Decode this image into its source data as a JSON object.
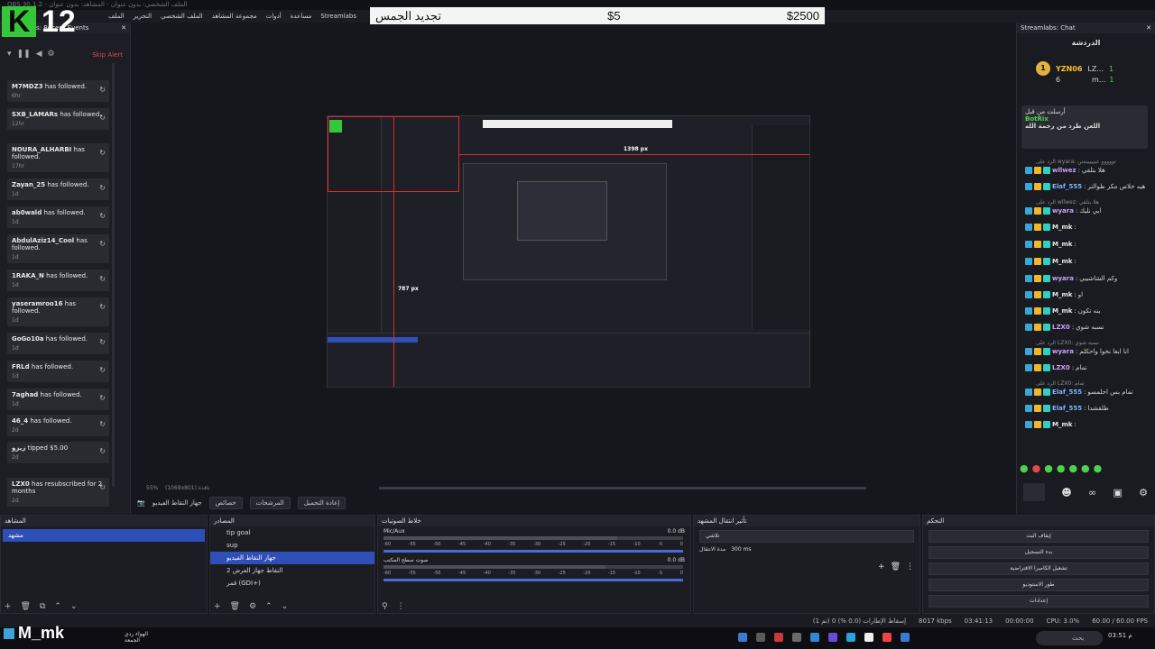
{
  "window": {
    "title": "OBS 30.1.2 - الملف الشخصي: بدون عنوان - المشاهد: بدون عنوان"
  },
  "menu": [
    "الملف",
    "التحرير",
    "الملف الشخصي",
    "مجموعة المشاهد",
    "أدوات",
    "مساعدة",
    "Streamlabs"
  ],
  "logo": {
    "letter": "K",
    "number": "12"
  },
  "goal": {
    "title": "تجديد الجمس",
    "amount": "$5",
    "target": "$2500"
  },
  "events_panel": {
    "title": "Streamlabs: Recent Events",
    "skip_label": "Skip Alert",
    "items": [
      {
        "name": "M7MDZ3",
        "text": " has followed.",
        "time": "6hr"
      },
      {
        "name": "SXB_LAMARs",
        "text": " has followed.",
        "time": "12hr"
      },
      {
        "name": "NOURA_ALHARBI",
        "text": " has followed.",
        "time": "17hr"
      },
      {
        "name": "Zayan_25",
        "text": " has followed.",
        "time": "1d"
      },
      {
        "name": "ab0wald",
        "text": " has followed.",
        "time": "1d"
      },
      {
        "name": "AbdulAziz14_Cool",
        "text": " has followed.",
        "time": "1d"
      },
      {
        "name": "1RAKA_N",
        "text": " has followed.",
        "time": "1d"
      },
      {
        "name": "yaseramroo16",
        "text": " has followed.",
        "time": "1d"
      },
      {
        "name": "GoGo10a",
        "text": " has followed.",
        "time": "1d"
      },
      {
        "name": "FRLd",
        "text": " has followed.",
        "time": "1d"
      },
      {
        "name": "7aghad",
        "text": " has followed.",
        "time": "1d"
      },
      {
        "name": "46_4",
        "text": " has followed.",
        "time": "2d"
      },
      {
        "name": "زيزو",
        "text": " tipped $5.00",
        "time": "2d"
      },
      {
        "name": "LZX0",
        "text": " has resubscribed for 2 months",
        "time": "2d"
      }
    ]
  },
  "preview": {
    "width_label": "1398 px",
    "height_label": "787 px",
    "zoom": "55%",
    "status": "(1069x801) نافذة"
  },
  "scene_tools": [
    "إعادة التحميل",
    "المرشحات",
    "خصائص",
    "جهاز التقاط الفيديو"
  ],
  "chat": {
    "title": "Streamlabs: Chat",
    "heading": "الدردشة",
    "top": [
      {
        "name": "YZN06",
        "count": "6"
      },
      {
        "name": "LZ...",
        "count": "1"
      },
      {
        "name": "m...",
        "count": "1"
      }
    ],
    "pinned": {
      "label": "أرسلت من قبل",
      "user": "BotRix",
      "text": "اللعن طرد من رحمة الله"
    },
    "messages": [
      {
        "reply": "الرد على wyara: تووووو عيييييينننن",
        "user": "wllwez",
        "text": "هلا بتلقي",
        "color": "#c9a0ff"
      },
      {
        "user": "Elaf_555",
        "text": "هيه خلاص مكر طوالتر",
        "color": "#79b6ff"
      },
      {
        "reply": "الرد على wllwez: هلا بتلقي",
        "user": "wyara",
        "text": "ابي نليك",
        "color": "#c9a0ff"
      },
      {
        "user": "M_mk",
        "text": "",
        "color": "#e6e6e6"
      },
      {
        "user": "M_mk",
        "text": "",
        "color": "#e6e6e6"
      },
      {
        "user": "M_mk",
        "text": "",
        "color": "#e6e6e6"
      },
      {
        "user": "wyara",
        "text": "وكم الشاشيبي",
        "color": "#c9a0ff"
      },
      {
        "user": "M_mk",
        "text": "او",
        "color": "#e6e6e6"
      },
      {
        "user": "M_mk",
        "text": "ينه تكون",
        "color": "#e6e6e6"
      },
      {
        "user": "LZX0",
        "text": "نسبه شوي",
        "color": "#c9a0ff"
      },
      {
        "reply": "الرد على LZX0: نسبه شوي",
        "user": "wyara",
        "text": "انا ابغا نخوا واحكلم",
        "color": "#c9a0ff"
      },
      {
        "user": "LZX0",
        "text": "تمام",
        "color": "#c9a0ff"
      },
      {
        "reply": "الرد على LZX0: تمام",
        "user": "Elaf_555",
        "text": "تمام بس احلمسو",
        "color": "#79b6ff"
      },
      {
        "user": "Elaf_555",
        "text": "طلقشدا",
        "color": "#79b6ff"
      },
      {
        "user": "M_mk",
        "text": "",
        "color": "#e6e6e6"
      }
    ]
  },
  "docks": {
    "scenes": {
      "title": "المشاهد",
      "items": [
        "مشهد"
      ]
    },
    "sources": {
      "title": "المصادر",
      "items": [
        "tip goal",
        "sup",
        "جهاز التقاط الفيديو",
        "التقاط جهاز العرض 2",
        "قمر (GDI+)"
      ]
    },
    "mixer": {
      "title": "خلاط الصوتيات",
      "channels": [
        {
          "name": "Mic/Aux",
          "db": "0.0 dB",
          "level": 0.78
        },
        {
          "name": "صوت سطح المكتب",
          "db": "0.0 dB",
          "level": 0.74
        }
      ],
      "scale": [
        "-60",
        "-55",
        "-50",
        "-45",
        "-40",
        "-35",
        "-30",
        "-25",
        "-20",
        "-15",
        "-10",
        "-5",
        "0"
      ]
    },
    "transitions": {
      "title": "تأثير انتقال المشهد",
      "selected": "تلاشي",
      "duration_label": "مدة الانتقال",
      "duration": "300 ms"
    },
    "controls": {
      "title": "التحكم",
      "buttons": [
        "إيقاف البث",
        "بدء التسجيل",
        "تشغيل الكاميرا الافتراضية",
        "طور الاستوديو",
        "إعدادات"
      ]
    }
  },
  "statusbar": {
    "dropped": "إسقاط الإطارات (0.0 %) 0 (تم 1)",
    "bitrate": "8017 kbps",
    "time": "03:41:13",
    "time2": "00:00:00",
    "cpu": "CPU: 3.0%",
    "fps": "60.00 / 60.00 FPS"
  },
  "taskbar": {
    "user": "M_mk",
    "weather": "الهواء ردي",
    "day": "الجمعة",
    "search": "بحث",
    "clock": "03:51 م"
  }
}
